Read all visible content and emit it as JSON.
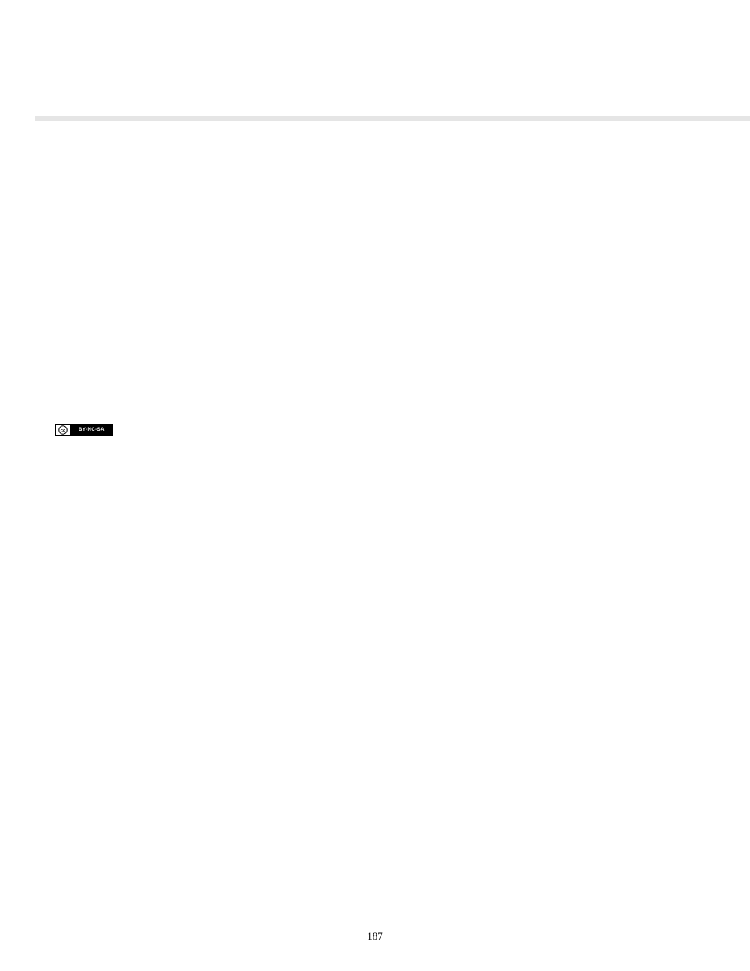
{
  "license_badge": {
    "logo_label": "cc",
    "terms_label": "BY-NC-SA"
  },
  "page_number": "187"
}
